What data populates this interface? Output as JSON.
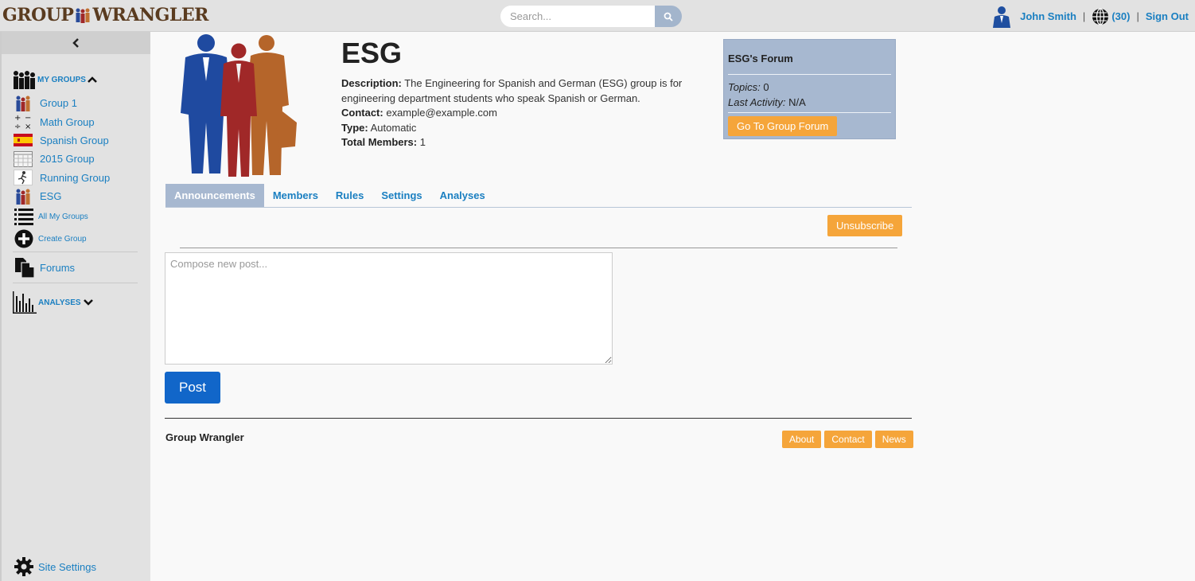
{
  "brand": {
    "logo_left": "GROUP",
    "logo_right": "WRANGLER"
  },
  "search": {
    "placeholder": "Search..."
  },
  "user": {
    "name": "John Smith",
    "notification_count": "(30)",
    "sign_out": "Sign Out"
  },
  "sidebar": {
    "my_groups_label": "MY GROUPS",
    "groups": [
      {
        "label": "Group 1",
        "icon": "people-icon"
      },
      {
        "label": "Math Group",
        "icon": "math-operators-icon"
      },
      {
        "label": "Spanish Group",
        "icon": "spain-flag-icon"
      },
      {
        "label": "2015 Group",
        "icon": "calendar-icon"
      },
      {
        "label": "Running Group",
        "icon": "runner-icon"
      },
      {
        "label": "ESG",
        "icon": "people-icon"
      }
    ],
    "all_my_groups": "All My Groups",
    "create_group": "Create Group",
    "forums": "Forums",
    "analyses_label": "ANALYSES",
    "site_settings": "Site Settings"
  },
  "group": {
    "title": "ESG",
    "description_label": "Description:",
    "description": "The Engineering for Spanish and German (ESG) group is for engineering department students who speak Spanish or German.",
    "contact_label": "Contact:",
    "contact": "example@example.com",
    "type_label": "Type:",
    "type": "Automatic",
    "members_label": "Total Members:",
    "members": "1"
  },
  "forum": {
    "title": "ESG's Forum",
    "topics_label": "Topics:",
    "topics": "0",
    "activity_label": "Last Activity:",
    "activity": "N/A",
    "button": "Go To Group Forum"
  },
  "tabs": [
    {
      "label": "Announcements",
      "active": true
    },
    {
      "label": "Members",
      "active": false
    },
    {
      "label": "Rules",
      "active": false
    },
    {
      "label": "Settings",
      "active": false
    },
    {
      "label": "Analyses",
      "active": false
    }
  ],
  "announcements": {
    "unsubscribe": "Unsubscribe",
    "compose_placeholder": "Compose new post...",
    "post": "Post"
  },
  "footer": {
    "brand": "Group Wrangler",
    "links": [
      "About",
      "Contact",
      "News"
    ]
  },
  "colors": {
    "link": "#1a7fc1",
    "accent_orange": "#f5a53a",
    "tab_active": "#a7b8d0",
    "post_blue": "#1166c9"
  }
}
